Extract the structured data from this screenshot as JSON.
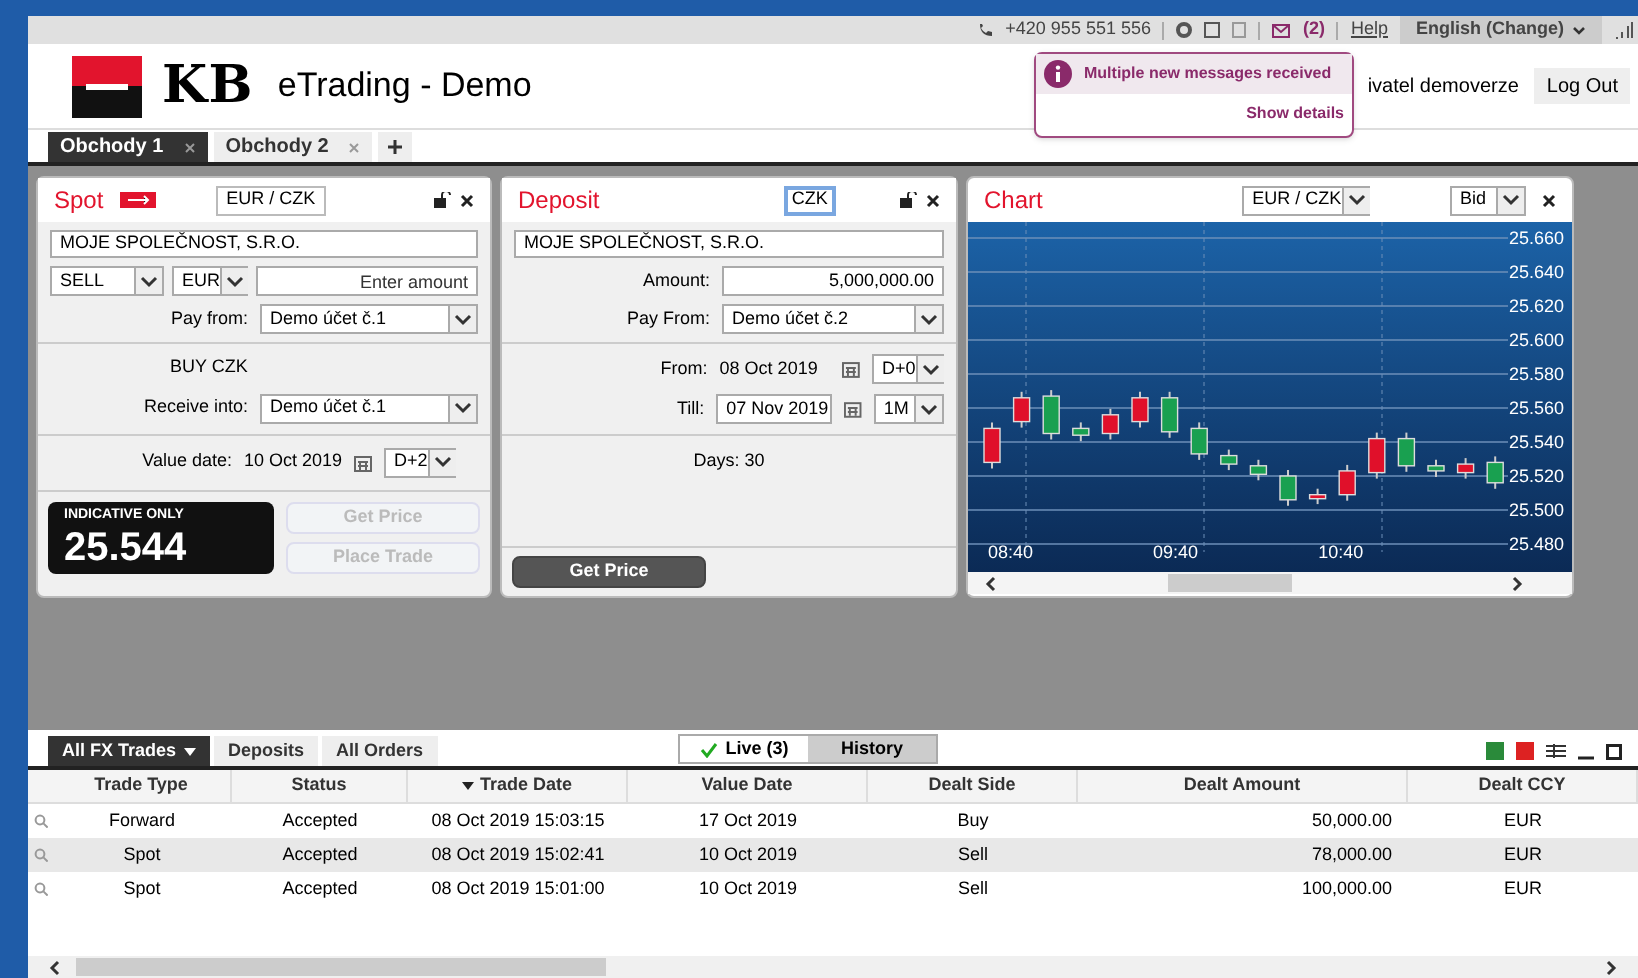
{
  "top_bar": {
    "phone": "+420 955 551 556",
    "message_count": "(2)",
    "help": "Help",
    "language": "English (Change)"
  },
  "header": {
    "logo": "KB",
    "title": "eTrading - Demo",
    "user": "ivatel demoverze",
    "logout": "Log Out"
  },
  "notification": {
    "message": "Multiple new messages received",
    "link": "Show details"
  },
  "workspace_tabs": [
    {
      "label": "Obchody 1",
      "selected": true
    },
    {
      "label": "Obchody 2",
      "selected": false
    }
  ],
  "spot": {
    "title": "Spot",
    "pair": "EUR / CZK",
    "company": "MOJE SPOLEČNOST, S.R.O.",
    "side": "SELL",
    "currency": "EUR",
    "amount_placeholder": "Enter amount",
    "pay_from_label": "Pay from:",
    "pay_from": "Demo účet č.1",
    "buy_label": "BUY CZK",
    "receive_label": "Receive into:",
    "receive": "Demo účet č.1",
    "value_date_label": "Value date:",
    "value_date": "10 Oct 2019",
    "tenor": "D+2",
    "indicative_label": "INDICATIVE ONLY",
    "rate": "25.544",
    "buttons": [
      {
        "label": "Get Price",
        "disabled": true
      },
      {
        "label": "Place Trade",
        "disabled": true
      }
    ]
  },
  "deposit": {
    "title": "Deposit",
    "currency": "CZK",
    "company": "MOJE SPOLEČNOST, S.R.O.",
    "amount_label": "Amount:",
    "amount": "5,000,000.00",
    "pay_from_label": "Pay From:",
    "pay_from": "Demo účet č.2",
    "from_label": "From:",
    "from": "08 Oct 2019",
    "from_tenor": "D+0",
    "till_label": "Till:",
    "till": "07 Nov 2019",
    "till_tenor": "1M",
    "days": "Days: 30",
    "button": {
      "label": "Get Price",
      "disabled": false
    }
  },
  "chart": {
    "title": "Chart",
    "pair": "EUR / CZK",
    "side": "Bid",
    "y_labels": [
      "25.660",
      "25.640",
      "25.620",
      "25.600",
      "25.580",
      "25.560",
      "25.540",
      "25.520",
      "25.500",
      "25.480"
    ],
    "x_labels": [
      "08:40",
      "09:40",
      "10:40"
    ]
  },
  "trades": {
    "tabs": [
      {
        "label": "All FX Trades",
        "selected": true
      },
      {
        "label": "Deposits",
        "selected": false
      },
      {
        "label": "All Orders",
        "selected": false
      }
    ],
    "filters": [
      {
        "label": "Live (3)",
        "selected": true
      },
      {
        "label": "History",
        "selected": false
      }
    ],
    "columns": [
      "Trade Type",
      "Status",
      "Trade Date",
      "Value Date",
      "Dealt Side",
      "Dealt Amount",
      "Dealt CCY"
    ],
    "rows": [
      {
        "cells": [
          "Forward",
          "Accepted",
          "08 Oct 2019 15:03:15",
          "17 Oct 2019",
          "Buy",
          "50,000.00",
          "EUR"
        ]
      },
      {
        "cells": [
          "Spot",
          "Accepted",
          "08 Oct 2019 15:02:41",
          "10 Oct 2019",
          "Sell",
          "78,000.00",
          "EUR"
        ]
      },
      {
        "cells": [
          "Spot",
          "Accepted",
          "08 Oct 2019 15:01:00",
          "10 Oct 2019",
          "Sell",
          "100,000.00",
          "EUR"
        ]
      }
    ]
  }
}
